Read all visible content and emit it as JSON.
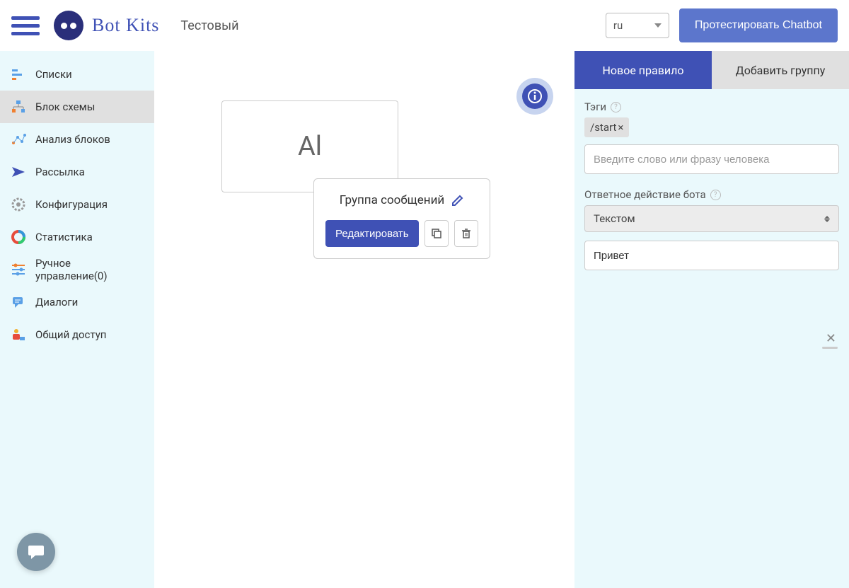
{
  "header": {
    "logo_text": "Bot Kits",
    "project_name": "Тестовый",
    "lang": "ru",
    "test_button": "Протестировать Chatbot"
  },
  "sidebar": {
    "items": [
      {
        "label": "Списки",
        "id": "lists"
      },
      {
        "label": "Блок схемы",
        "id": "block-schemes",
        "active": true
      },
      {
        "label": "Анализ блоков",
        "id": "block-analysis"
      },
      {
        "label": "Рассылка",
        "id": "broadcast"
      },
      {
        "label": "Конфигурация",
        "id": "configuration"
      },
      {
        "label": "Статистика",
        "id": "statistics"
      },
      {
        "label": "Ручное управление(0)",
        "id": "manual-control"
      },
      {
        "label": "Диалоги",
        "id": "dialogs"
      },
      {
        "label": "Общий доступ",
        "id": "sharing"
      }
    ]
  },
  "canvas": {
    "al_block": "Al",
    "group_title": "Группа сообщений",
    "edit_button": "Редактировать"
  },
  "right_panel": {
    "tabs": {
      "new_rule": "Новое правило",
      "add_group": "Добавить группу"
    },
    "tags_label": "Тэги",
    "tag_value": "/start",
    "phrase_placeholder": "Введите слово или фразу человека",
    "response_label": "Ответное действие бота",
    "response_type": "Текстом",
    "response_value": "Привет"
  }
}
